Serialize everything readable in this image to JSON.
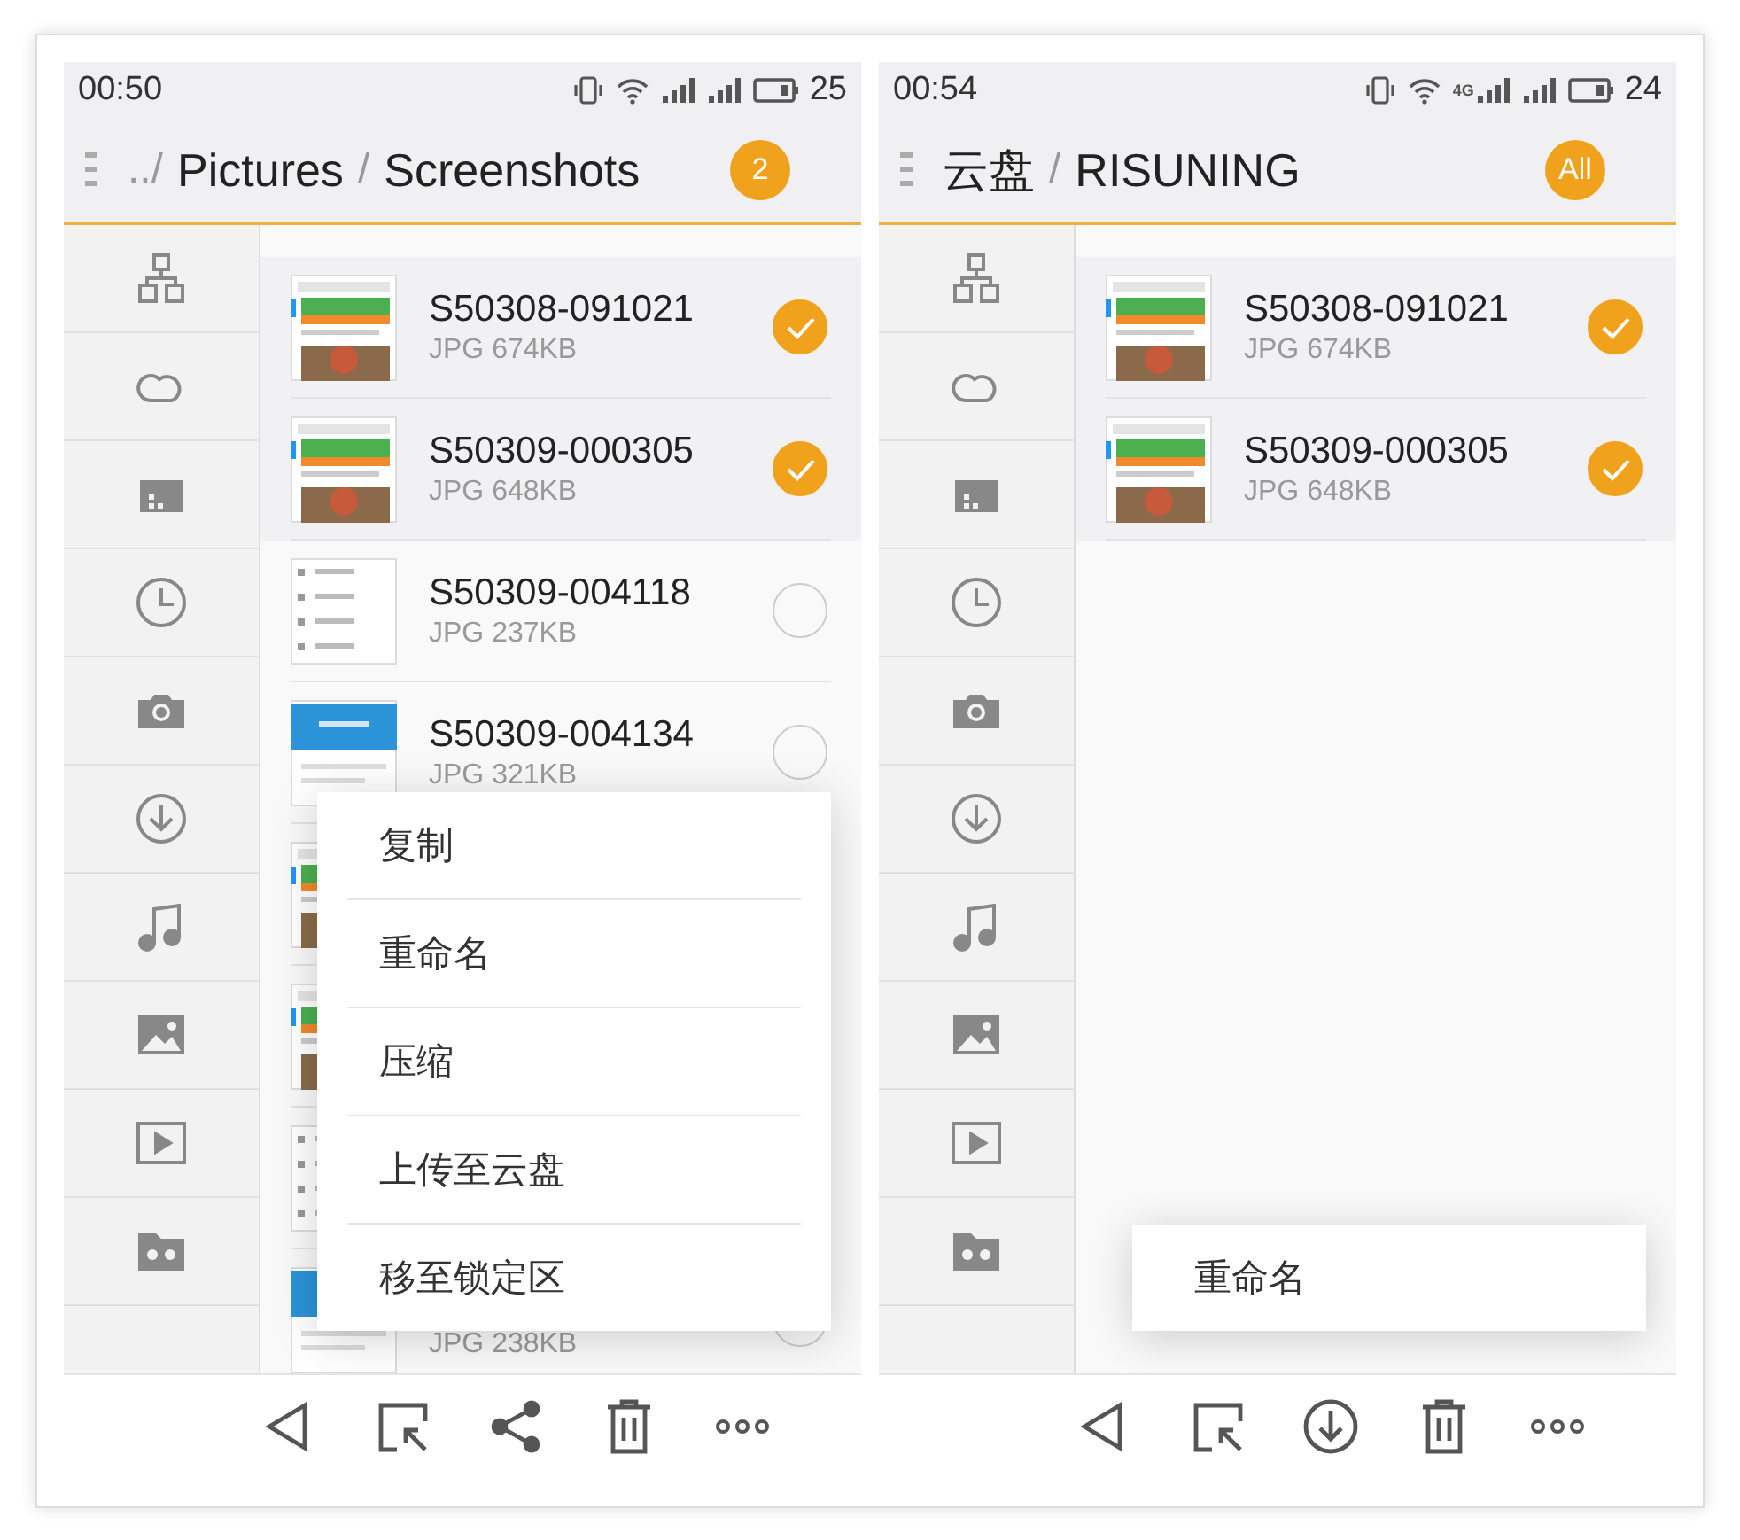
{
  "screens": [
    {
      "status_bar": {
        "time": "00:50",
        "battery": "25"
      },
      "breadcrumb": [
        {
          "text": "../",
          "kind": "sep"
        },
        {
          "text": "Pictures",
          "kind": "dir"
        },
        {
          "text": "/",
          "kind": "sep"
        },
        {
          "text": "Screenshots",
          "kind": "dir"
        }
      ],
      "badge": "2",
      "files": [
        {
          "name": "S50308-091021",
          "size": "JPG 674KB",
          "selected": true
        },
        {
          "name": "S50309-000305",
          "size": "JPG 648KB",
          "selected": true
        },
        {
          "name": "S50309-004118",
          "size": "JPG 237KB",
          "selected": false
        },
        {
          "name": "S50309-004134",
          "size": "JPG 321KB",
          "selected": false
        },
        {
          "thumbnail": {
            "kind": "picture"
          }
        },
        {
          "thumbnail": {
            "kind": "picture"
          }
        },
        {
          "thumbnail": {
            "kind": "picture"
          }
        },
        {
          "size": "JPG 238KB",
          "selected": false
        }
      ],
      "menu": [
        {
          "label": "复制"
        },
        {
          "label": "重命名"
        },
        {
          "label": "压缩"
        },
        {
          "label": "上传至云盘"
        },
        {
          "label": "移至锁定区"
        }
      ],
      "toolbar": [
        {
          "kind": "back"
        },
        {
          "kind": "select"
        },
        {
          "kind": "share"
        },
        {
          "kind": "delete"
        },
        {
          "kind": "more"
        }
      ]
    },
    {
      "status_bar": {
        "time": "00:54",
        "network_label": "4G",
        "battery": "24"
      },
      "breadcrumb": [
        {
          "text": "云盘",
          "kind": "dir"
        },
        {
          "text": "/",
          "kind": "sep"
        },
        {
          "text": "RISUNING",
          "kind": "dir"
        }
      ],
      "badge": "All",
      "files": [
        {
          "name": "S50308-091021",
          "size": "JPG 674KB",
          "selected": true
        },
        {
          "name": "S50309-000305",
          "size": "JPG 648KB",
          "selected": true
        }
      ],
      "menu": [
        {
          "label": "重命名"
        }
      ],
      "toolbar": [
        {
          "kind": "back"
        },
        {
          "kind": "select"
        },
        {
          "kind": "download"
        },
        {
          "kind": "delete"
        },
        {
          "kind": "more"
        }
      ]
    }
  ]
}
